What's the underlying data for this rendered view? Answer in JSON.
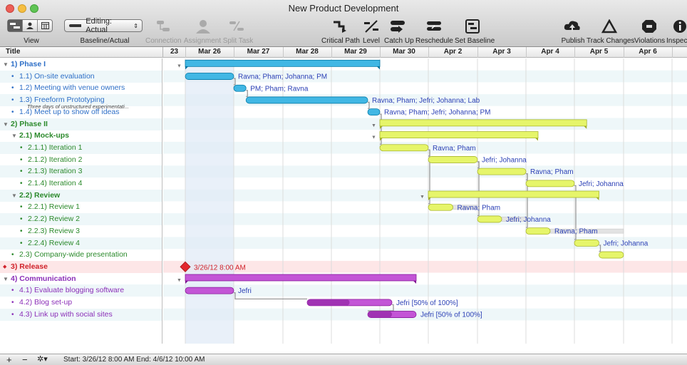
{
  "window": {
    "title": "New Product Development",
    "traffic_colors": [
      "#ec5f57",
      "#f5be41",
      "#5fc454"
    ]
  },
  "toolbar": {
    "view_label": "View",
    "editing_popup": "Editing: Actual",
    "baseline_label": "Baseline/Actual",
    "connection_label": "Connection",
    "assignment_label": "Assignment",
    "split_label": "Split Task",
    "critical_label": "Critical Path",
    "level_label": "Level",
    "catchup_label": "Catch Up",
    "reschedule_label": "Reschedule",
    "setbaseline_label": "Set Baseline",
    "publish_label": "Publish",
    "track_label": "Track Changes",
    "violations_label": "Violations",
    "inspector_label": "Inspec"
  },
  "outline": {
    "title_header": "Title",
    "rows": [
      {
        "label": "1)  Phase I",
        "level": 0,
        "type": "group",
        "color": "#2e6fc7"
      },
      {
        "label": "1.1)  On-site evaluation",
        "level": 1,
        "type": "task",
        "color": "#2e6fc7"
      },
      {
        "label": "1.2)  Meeting with venue owners",
        "level": 1,
        "type": "task",
        "color": "#2e6fc7"
      },
      {
        "label": "1.3)  Freeform Prototyping",
        "level": 1,
        "type": "task",
        "color": "#2e6fc7",
        "note": "Three days of unstructured experimentati..."
      },
      {
        "label": "1.4)  Meet up to show off ideas",
        "level": 1,
        "type": "task",
        "color": "#2e6fc7"
      },
      {
        "label": "2)  Phase II",
        "level": 0,
        "type": "group",
        "color": "#2c8a2c"
      },
      {
        "label": "2.1)  Mock-ups",
        "level": 1,
        "type": "group",
        "color": "#2c8a2c"
      },
      {
        "label": "2.1.1)  Iteration 1",
        "level": 2,
        "type": "task",
        "color": "#2c8a2c"
      },
      {
        "label": "2.1.2)  Iteration 2",
        "level": 2,
        "type": "task",
        "color": "#2c8a2c"
      },
      {
        "label": "2.1.3)  Iteration 3",
        "level": 2,
        "type": "task",
        "color": "#2c8a2c"
      },
      {
        "label": "2.1.4)  Iteration 4",
        "level": 2,
        "type": "task",
        "color": "#2c8a2c"
      },
      {
        "label": "2.2)  Review",
        "level": 1,
        "type": "group",
        "color": "#2c8a2c"
      },
      {
        "label": "2.2.1)  Review 1",
        "level": 2,
        "type": "task",
        "color": "#2c8a2c"
      },
      {
        "label": "2.2.2)  Review 2",
        "level": 2,
        "type": "task",
        "color": "#2c8a2c"
      },
      {
        "label": "2.2.3)  Review 3",
        "level": 2,
        "type": "task",
        "color": "#2c8a2c"
      },
      {
        "label": "2.2.4)  Review 4",
        "level": 2,
        "type": "task",
        "color": "#2c8a2c"
      },
      {
        "label": "2.3)  Company-wide presentation",
        "level": 1,
        "type": "task",
        "color": "#2c8a2c"
      },
      {
        "label": "3)  Release",
        "level": 0,
        "type": "milestone",
        "color": "#d0232b"
      },
      {
        "label": "4)  Communication",
        "level": 0,
        "type": "group",
        "color": "#8b2fb8"
      },
      {
        "label": "4.1)  Evaluate blogging software",
        "level": 1,
        "type": "task",
        "color": "#8b2fb8"
      },
      {
        "label": "4.2)  Blog set-up",
        "level": 1,
        "type": "task",
        "color": "#8b2fb8"
      },
      {
        "label": "4.3)  Link up with social sites",
        "level": 1,
        "type": "task",
        "color": "#8b2fb8"
      }
    ]
  },
  "timeline": {
    "headers": [
      "23",
      "Mar 26",
      "Mar 27",
      "Mar 28",
      "Mar 29",
      "Mar 30",
      "Apr 2",
      "Apr 3",
      "Apr 4",
      "Apr 5",
      "Apr 6"
    ]
  },
  "gantt": {
    "bars": [
      {
        "row": 0,
        "start": 1.0,
        "end": 5.0,
        "kind": "group",
        "color": "#41b7e4"
      },
      {
        "row": 1,
        "start": 1.0,
        "end": 2.0,
        "kind": "task",
        "color": "#41b7e4",
        "label": "Ravna; Pham; Johanna; PM"
      },
      {
        "row": 2,
        "start": 2.0,
        "end": 2.25,
        "kind": "task",
        "color": "#41b7e4",
        "label": "PM; Pham; Ravna"
      },
      {
        "row": 3,
        "start": 2.25,
        "end": 4.75,
        "kind": "task",
        "color": "#41b7e4",
        "label": "Ravna; Pham; Jefri; Johanna; Lab"
      },
      {
        "row": 4,
        "start": 4.75,
        "end": 5.0,
        "kind": "task",
        "color": "#41b7e4",
        "label": "Ravna; Pham; Jefri; Johanna; PM"
      },
      {
        "row": 5,
        "start": 5.0,
        "end": 9.25,
        "kind": "group",
        "color": "#e6f56a"
      },
      {
        "row": 6,
        "start": 5.0,
        "end": 8.25,
        "kind": "group",
        "color": "#e6f56a"
      },
      {
        "row": 7,
        "start": 5.0,
        "end": 6.0,
        "kind": "task",
        "color": "#e6f56a",
        "label": "Ravna; Pham"
      },
      {
        "row": 8,
        "start": 6.0,
        "end": 7.0,
        "kind": "task",
        "color": "#e6f56a",
        "label": "Jefri; Johanna"
      },
      {
        "row": 9,
        "start": 7.0,
        "end": 8.0,
        "kind": "task",
        "color": "#e6f56a",
        "label": "Ravna; Pham"
      },
      {
        "row": 10,
        "start": 8.0,
        "end": 9.0,
        "kind": "task",
        "color": "#e6f56a",
        "label": "Jefri; Johanna"
      },
      {
        "row": 11,
        "start": 6.0,
        "end": 9.5,
        "kind": "group",
        "color": "#e6f56a"
      },
      {
        "row": 12,
        "start": 6.0,
        "end": 6.5,
        "kind": "task",
        "color": "#e6f56a",
        "label": "Ravna; Pham",
        "slack_end": 7.0
      },
      {
        "row": 13,
        "start": 7.0,
        "end": 7.5,
        "kind": "task",
        "color": "#e6f56a",
        "label": "Jefri; Johanna",
        "slack_end": 8.0
      },
      {
        "row": 14,
        "start": 8.0,
        "end": 8.5,
        "kind": "task",
        "color": "#e6f56a",
        "label": "Ravna; Pham",
        "slack_end": 10.0
      },
      {
        "row": 15,
        "start": 9.0,
        "end": 9.5,
        "kind": "task",
        "color": "#e6f56a",
        "label": "Jefri; Johanna"
      },
      {
        "row": 16,
        "start": 9.5,
        "end": 10.0,
        "kind": "task",
        "color": "#e6f56a"
      },
      {
        "row": 18,
        "start": 1.0,
        "end": 5.75,
        "kind": "group",
        "color": "#c355d6"
      },
      {
        "row": 19,
        "start": 1.0,
        "end": 2.0,
        "kind": "task",
        "color": "#c355d6",
        "label": "Jefri"
      },
      {
        "row": 20,
        "start": 3.5,
        "end": 5.25,
        "kind": "task",
        "color": "#c355d6",
        "label": "Jefri [50% of 100%]",
        "progress": 0.5
      },
      {
        "row": 21,
        "start": 4.75,
        "end": 5.75,
        "kind": "task",
        "color": "#c355d6",
        "label": "Jefri [50% of 100%]",
        "progress": 0.5
      }
    ],
    "milestone": {
      "row": 17,
      "at": 1.0,
      "label": "3/26/12 8:00 AM",
      "color": "#e3262d"
    }
  },
  "status": {
    "text": "Start: 3/26/12 8:00 AM  End: 4/6/12 10:00 AM"
  }
}
